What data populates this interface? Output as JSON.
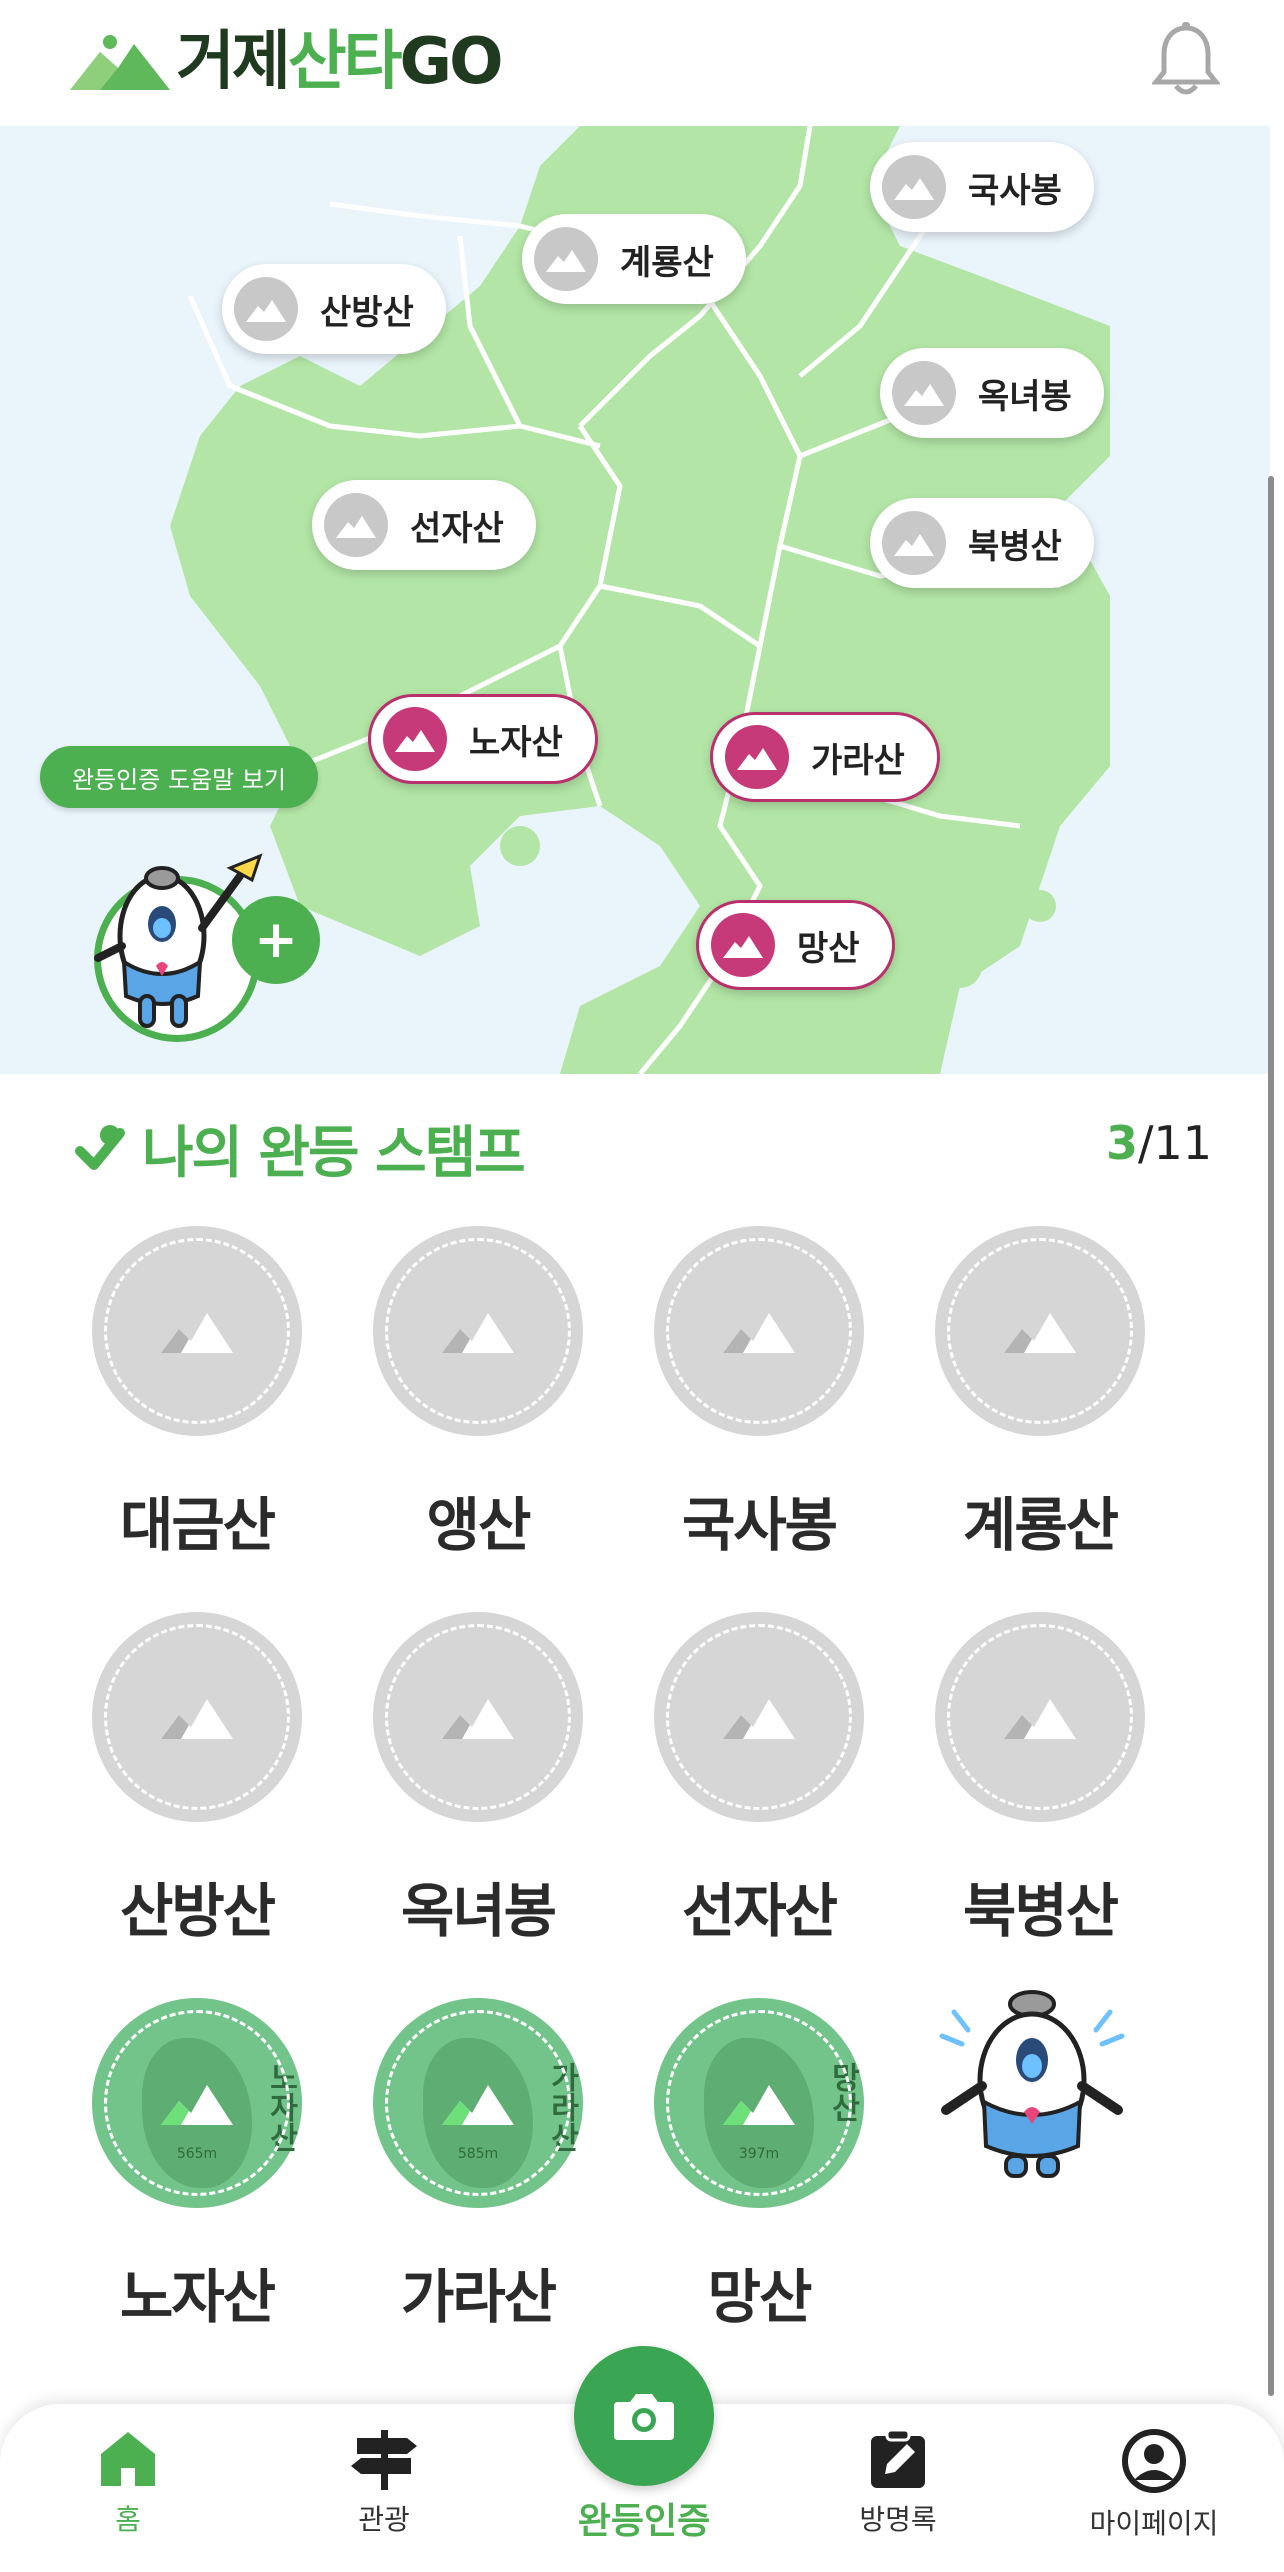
{
  "header": {
    "logo_part1": "거제",
    "logo_part2": "산타",
    "logo_part3": "GO",
    "icons": {
      "logo": "mountain-logo-icon",
      "notification": "bell-icon"
    }
  },
  "map": {
    "pins": [
      {
        "label": "국사봉",
        "status": "not-climbed"
      },
      {
        "label": "계룡산",
        "status": "not-climbed"
      },
      {
        "label": "산방산",
        "status": "not-climbed"
      },
      {
        "label": "옥녀봉",
        "status": "not-climbed"
      },
      {
        "label": "선자산",
        "status": "not-climbed"
      },
      {
        "label": "북병산",
        "status": "not-climbed"
      },
      {
        "label": "노자산",
        "status": "climbed"
      },
      {
        "label": "가라산",
        "status": "climbed"
      },
      {
        "label": "망산",
        "status": "climbed"
      }
    ],
    "help_button_label": "완등인증 도움말 보기",
    "plus_label": "+",
    "colors": {
      "sea": "#e9f4fb",
      "land": "#b3e6a6",
      "climbed_pin": "#c63a7a"
    }
  },
  "stamps": {
    "title": "나의 완등 스탬프",
    "count_done": "3",
    "count_total": "/11",
    "items": [
      {
        "name": "대금산",
        "done": false
      },
      {
        "name": "앵산",
        "done": false
      },
      {
        "name": "국사봉",
        "done": false
      },
      {
        "name": "계룡산",
        "done": false
      },
      {
        "name": "산방산",
        "done": false
      },
      {
        "name": "옥녀봉",
        "done": false
      },
      {
        "name": "선자산",
        "done": false
      },
      {
        "name": "북병산",
        "done": false
      },
      {
        "name": "노자산",
        "done": true,
        "badge_text": "노자산",
        "altitude": "565m"
      },
      {
        "name": "가라산",
        "done": true,
        "badge_text": "가라산",
        "altitude": "585m"
      },
      {
        "name": "망산",
        "done": true,
        "badge_text": "망산",
        "altitude": "397m"
      }
    ]
  },
  "bottom_nav": {
    "home": "홈",
    "tour": "관광",
    "certify": "완등인증",
    "guestbook": "방명록",
    "mypage": "마이페이지",
    "active": "home",
    "accent": "#4caf50"
  }
}
